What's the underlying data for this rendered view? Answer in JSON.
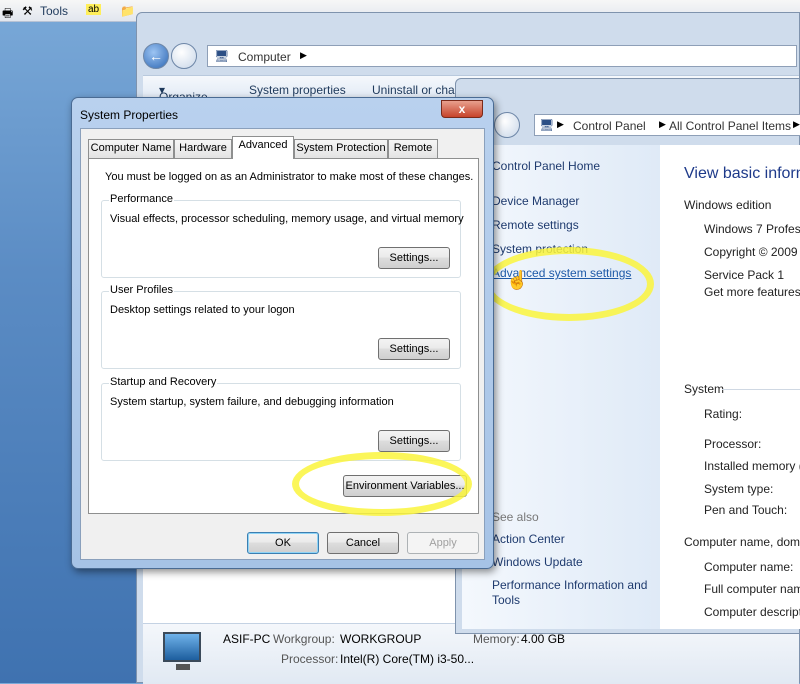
{
  "topstrip": {
    "tools_label": "Tools",
    "menu_fragment": "ab"
  },
  "computer_window": {
    "breadcrumb": [
      "Computer"
    ],
    "toolbar": {
      "organize": "Organize",
      "system_properties": "System properties",
      "uninstall": "Uninstall or cha"
    },
    "details": {
      "pc_name": "ASIF-PC",
      "workgroup_label": "Workgroup:",
      "workgroup_value": "WORKGROUP",
      "memory_label": "Memory:",
      "memory_value": "4.00 GB",
      "processor_label": "Processor:",
      "processor_value": "Intel(R) Core(TM) i3-50..."
    }
  },
  "control_panel": {
    "breadcrumb": [
      "Control Panel",
      "All Control Panel Items"
    ],
    "left_nav": {
      "home": "Control Panel Home",
      "links": [
        "Device Manager",
        "Remote settings",
        "System protection",
        "Advanced system settings"
      ],
      "see_also_header": "See also",
      "see_also": [
        "Action Center",
        "Windows Update",
        "Performance Information and",
        "Tools"
      ]
    },
    "main": {
      "title": "View basic inform",
      "windows_edition_header": "Windows edition",
      "edition": "Windows 7 Profess",
      "copyright": "Copyright © 2009",
      "service_pack": "Service Pack 1",
      "more_features": "Get more features",
      "system_header": "System",
      "system_rows": [
        "Rating:",
        "Processor:",
        "Installed memory (",
        "System type:",
        "Pen and Touch:"
      ],
      "computer_name_header": "Computer name, dom",
      "computer_rows": [
        "Computer name:",
        "Full computer nam",
        "Computer descript"
      ]
    }
  },
  "dialog": {
    "title": "System Properties",
    "close": "x",
    "tabs": [
      "Computer Name",
      "Hardware",
      "Advanced",
      "System Protection",
      "Remote"
    ],
    "active_tab": "Advanced",
    "admin_note": "You must be logged on as an Administrator to make most of these changes.",
    "groups": [
      {
        "legend": "Performance",
        "desc": "Visual effects, processor scheduling, memory usage, and virtual memory",
        "button": "Settings..."
      },
      {
        "legend": "User Profiles",
        "desc": "Desktop settings related to your logon",
        "button": "Settings..."
      },
      {
        "legend": "Startup and Recovery",
        "desc": "System startup, system failure, and debugging information",
        "button": "Settings..."
      }
    ],
    "env_button": "Environment Variables...",
    "ok": "OK",
    "cancel": "Cancel",
    "apply": "Apply"
  },
  "colors": {
    "highlight": "#faf53c",
    "link": "#1e5aa8",
    "close_button": "#c7432a"
  }
}
